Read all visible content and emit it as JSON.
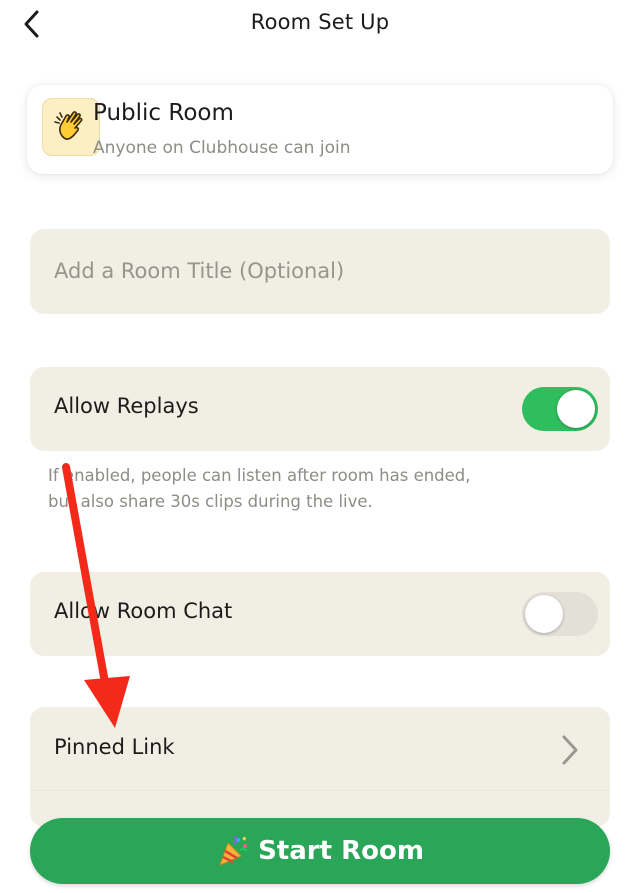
{
  "header": {
    "title": "Room Set Up",
    "back_icon": "chevron-left-icon"
  },
  "room_type": {
    "name": "Public Room",
    "description": "Anyone on Clubhouse can join",
    "icon": "waving-hand-icon"
  },
  "room_title_input": {
    "value": "",
    "placeholder": "Add a Room Title (Optional)"
  },
  "settings": {
    "allow_replays": {
      "label": "Allow Replays",
      "enabled": true,
      "hint": "If enabled, people can listen after room has ended, but also share 30s clips during the live."
    },
    "allow_room_chat": {
      "label": "Allow Room Chat",
      "enabled": false
    },
    "pinned_link": {
      "label": "Pinned Link",
      "icon": "chevron-right-icon"
    }
  },
  "start_button": {
    "label": "Start Room",
    "icon": "party-popper-icon"
  },
  "colors": {
    "accent_green": "#2aa659",
    "toggle_on": "#2fbe5e",
    "toggle_off": "#e2e0d7",
    "card_bg": "#f1efe4",
    "annotation_arrow": "#f5291a"
  }
}
